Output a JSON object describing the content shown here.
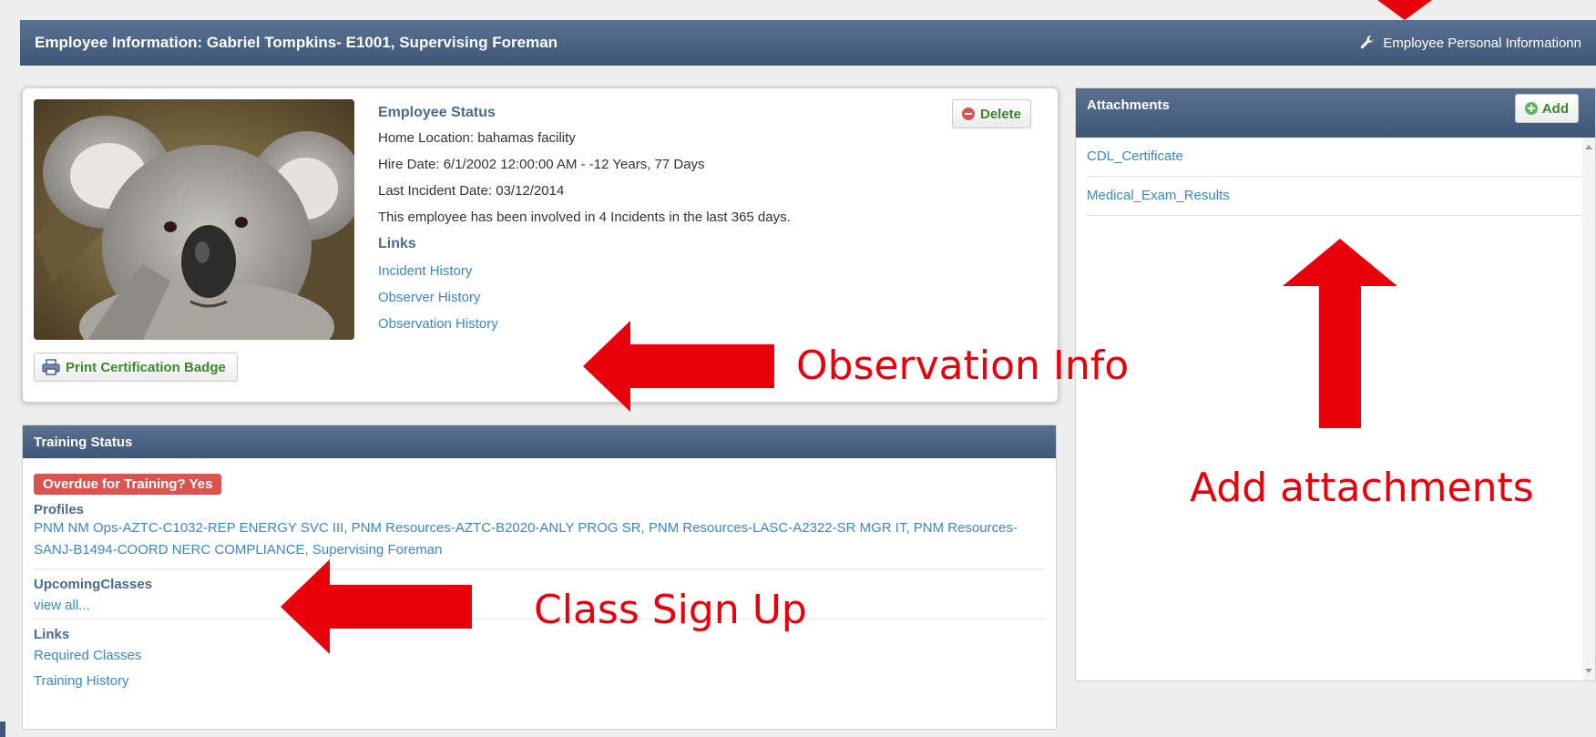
{
  "header": {
    "title": "Employee Information: Gabriel Tompkins- E1001, Supervising Foreman",
    "personal_info_link": "Employee Personal Informationn"
  },
  "employee_status": {
    "heading": "Employee Status",
    "home_location": "Home Location: bahamas facility",
    "hire_date": "Hire Date: 6/1/2002 12:00:00 AM - -12 Years, 77 Days",
    "last_incident": "Last Incident Date: 03/12/2014",
    "incident_summary": "This employee has been involved in 4 Incidents in the last 365 days.",
    "links_heading": "Links",
    "links": [
      "Incident History",
      "Observer History",
      "Observation History"
    ],
    "delete_label": "Delete",
    "print_badge_label": "Print Certification Badge"
  },
  "training_status": {
    "title": "Training Status",
    "overdue_badge": "Overdue for Training? Yes",
    "profiles_heading": "Profiles",
    "profiles_text": "PNM NM Ops-AZTC-C1032-REP ENERGY SVC III, PNM Resources-AZTC-B2020-ANLY PROG SR, PNM Resources-LASC-A2322-SR MGR IT, PNM Resources-SANJ-B1494-COORD NERC COMPLIANCE, Supervising Foreman",
    "upcoming_heading": "UpcomingClasses",
    "view_all": "view all...",
    "links_heading": "Links",
    "links": [
      "Required Classes",
      "Training History"
    ]
  },
  "attachments": {
    "title": "Attachments",
    "add_label": "Add",
    "items": [
      "CDL_Certificate",
      "Medical_Exam_Results"
    ]
  },
  "annotations": {
    "observation_info": "Observation Info",
    "add_attachments": "Add attachments",
    "class_sign_up": "Class Sign Up"
  },
  "colors": {
    "header_bg": "#3e5677",
    "link": "#3a87c8",
    "annotation_red": "#e8000b",
    "danger": "#d9534f",
    "success_text": "#3a8a2a"
  },
  "icons": [
    "wrench-icon",
    "printer-icon",
    "minus-circle-icon",
    "plus-circle-icon",
    "koala-photo"
  ]
}
